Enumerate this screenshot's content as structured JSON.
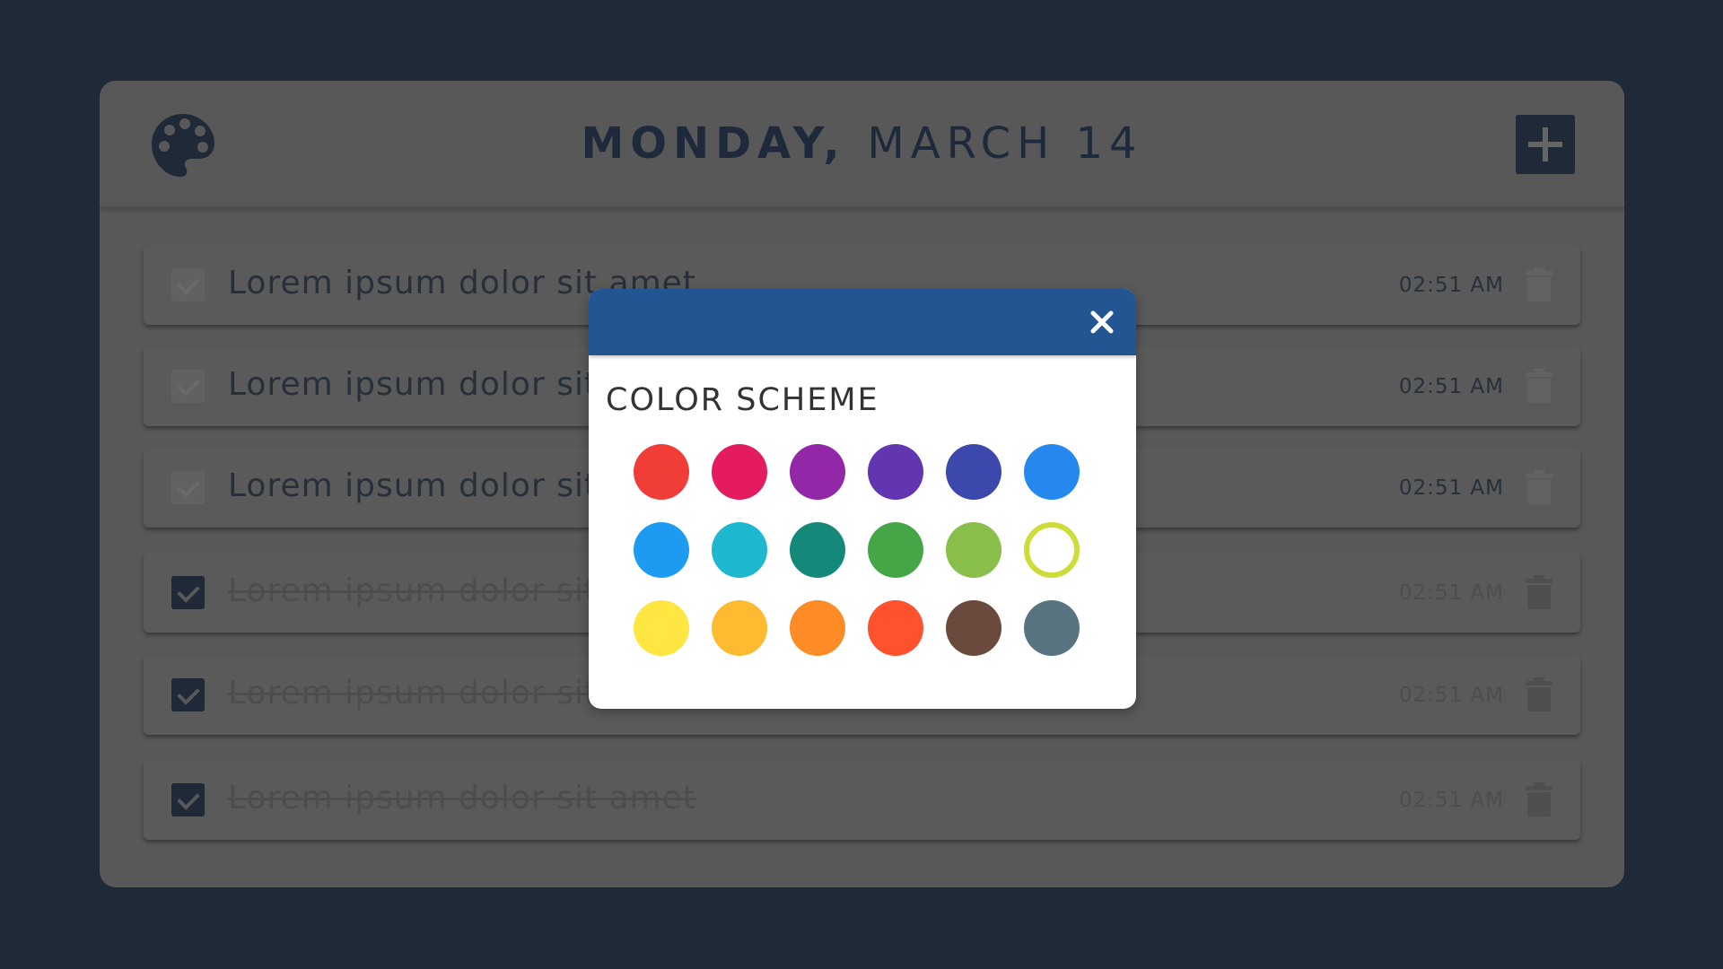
{
  "header": {
    "day": "MONDAY,",
    "month": "MARCH 14"
  },
  "tasks": [
    {
      "text": "Lorem ipsum dolor sit amet",
      "time": "02:51 AM",
      "done": false
    },
    {
      "text": "Lorem ipsum dolor sit",
      "time": "02:51 AM",
      "done": false
    },
    {
      "text": "Lorem ipsum dolor sit",
      "time": "02:51 AM",
      "done": false
    },
    {
      "text": "Lorem ipsum dolor sit",
      "time": "02:51 AM",
      "done": true
    },
    {
      "text": "Lorem ipsum dolor sit",
      "time": "02:51 AM",
      "done": true
    },
    {
      "text": "Lorem ipsum dolor sit amet",
      "time": "02:51 AM",
      "done": true
    }
  ],
  "modal": {
    "title": "COLOR SCHEME",
    "selected_index": 11,
    "colors": [
      "#f03d37",
      "#e41b5e",
      "#9227a8",
      "#6236b0",
      "#3c48ab",
      "#2588ef",
      "#1c9bf0",
      "#1eb7d0",
      "#14897a",
      "#45a647",
      "#88bf4a",
      "#cddc39",
      "#ffe642",
      "#fdbb31",
      "#fd8c27",
      "#fd522d",
      "#6b4a3e",
      "#587481"
    ]
  },
  "icons": {
    "palette": "palette-icon",
    "add": "plus-icon",
    "close": "close-icon",
    "trash": "trash-icon",
    "check": "check-icon"
  },
  "colors": {
    "background": "#1f2937",
    "card": "#585858",
    "modal_header": "#225591",
    "selected_ring": "#cddc39"
  }
}
